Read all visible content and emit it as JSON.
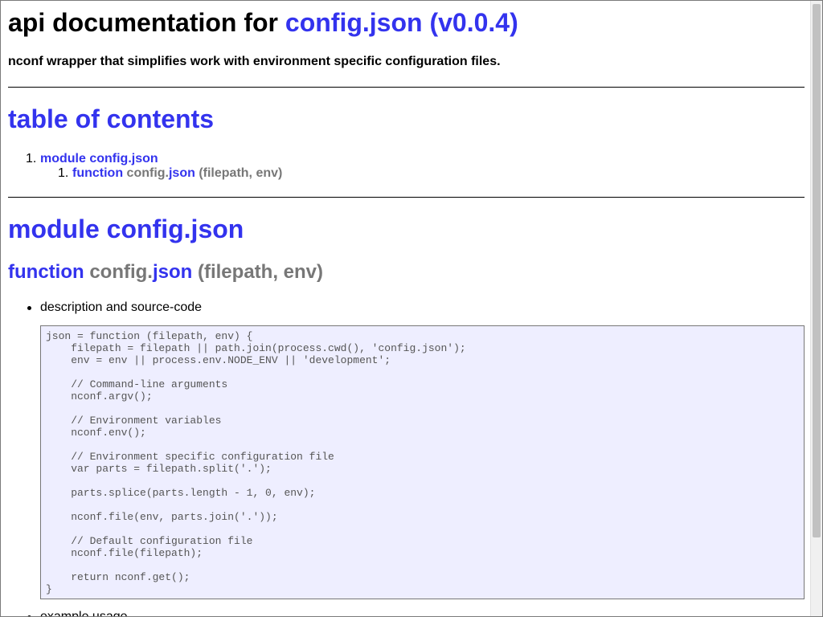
{
  "header": {
    "title_prefix": "api documentation for ",
    "title_link": "config.json (v0.0.4)",
    "description": "nconf wrapper that simplifies work with environment specific configuration files."
  },
  "toc": {
    "heading": "table of contents",
    "items": [
      {
        "number": "1.",
        "label": "module config.json"
      },
      {
        "number": "1.",
        "keyword": "function",
        "name_prefix": "config.",
        "name_link": "json",
        "signature": "(filepath, env)"
      }
    ]
  },
  "module": {
    "heading": "module config.json",
    "function": {
      "keyword": "function",
      "name_prefix": "config.",
      "name_link": "json",
      "signature": "(filepath, env)",
      "bullets": [
        "description and source-code",
        "example usage"
      ],
      "source_code": "json = function (filepath, env) {\n    filepath = filepath || path.join(process.cwd(), 'config.json');\n    env = env || process.env.NODE_ENV || 'development';\n\n    // Command-line arguments\n    nconf.argv();\n\n    // Environment variables\n    nconf.env();\n\n    // Environment specific configuration file\n    var parts = filepath.split('.');\n\n    parts.splice(parts.length - 1, 0, env);\n\n    nconf.file(env, parts.join('.'));\n\n    // Default configuration file\n    nconf.file(filepath);\n\n    return nconf.get();\n}"
    }
  },
  "colors": {
    "link": "#3333ee",
    "muted": "#777777",
    "code_background": "#eeeeff"
  }
}
